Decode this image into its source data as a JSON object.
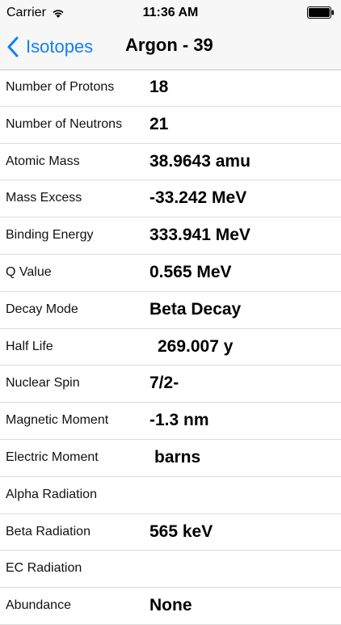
{
  "status": {
    "carrier": "Carrier",
    "time": "11:36 AM",
    "wifi_icon": "wifi-icon",
    "battery_icon": "battery-icon"
  },
  "nav": {
    "back_label": "Isotopes",
    "title": "Argon - 39",
    "accent": "#147efb"
  },
  "rows": [
    {
      "label": "Number of Protons",
      "value": "18"
    },
    {
      "label": "Number of Neutrons",
      "value": "21"
    },
    {
      "label": "Atomic Mass",
      "value": "38.9643 amu"
    },
    {
      "label": "Mass Excess",
      "value": "-33.242 MeV"
    },
    {
      "label": "Binding Energy",
      "value": "333.941 MeV"
    },
    {
      "label": "Q Value",
      "value": "0.565 MeV"
    },
    {
      "label": "Decay Mode",
      "value": "Beta Decay"
    },
    {
      "label": "Half Life",
      "value": "269.007 y"
    },
    {
      "label": "Nuclear Spin",
      "value": "7/2-"
    },
    {
      "label": "Magnetic Moment",
      "value": "-1.3 nm"
    },
    {
      "label": "Electric Moment",
      "value": "barns"
    },
    {
      "label": "Alpha Radiation",
      "value": ""
    },
    {
      "label": "Beta Radiation",
      "value": "565 keV"
    },
    {
      "label": "EC Radiation",
      "value": ""
    },
    {
      "label": "Abundance",
      "value": "None"
    }
  ]
}
